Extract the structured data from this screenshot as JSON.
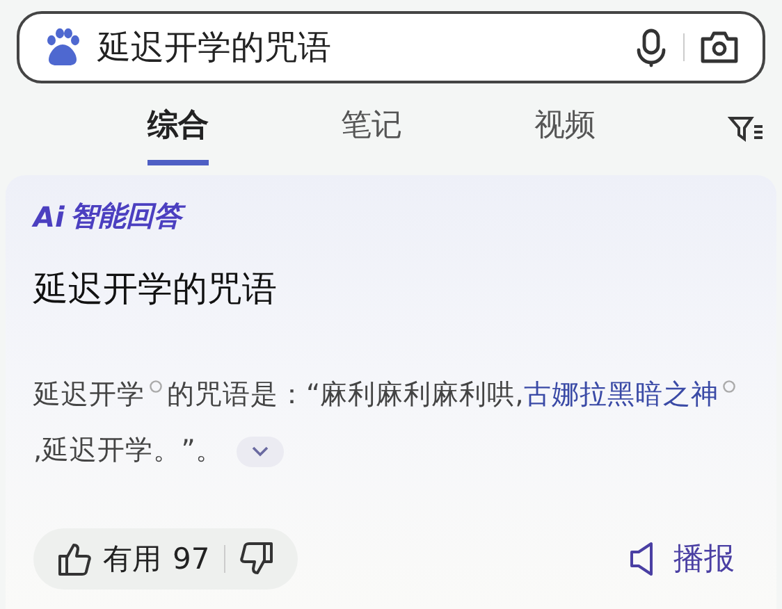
{
  "search": {
    "value": "延迟开学的咒语"
  },
  "tabs": [
    {
      "label": "综合",
      "selected": true
    },
    {
      "label": "笔记",
      "selected": false
    },
    {
      "label": "视频",
      "selected": false
    }
  ],
  "answer": {
    "badge_ai": "Ai",
    "badge": "智能回答",
    "title": "延迟开学的咒语",
    "segments": [
      {
        "text": "延迟开学",
        "link": false,
        "search_mark": true
      },
      {
        "text": "的咒语是：“麻利麻利麻利哄,",
        "link": false,
        "search_mark": false
      },
      {
        "text": "古娜拉黑暗之神",
        "link": true,
        "search_mark": true
      },
      {
        "text": ",延迟开学。”。",
        "link": false,
        "search_mark": false
      }
    ],
    "expanded": false
  },
  "feedback": {
    "useful_label": "有用",
    "useful_count": "97"
  },
  "read_aloud": "播报"
}
